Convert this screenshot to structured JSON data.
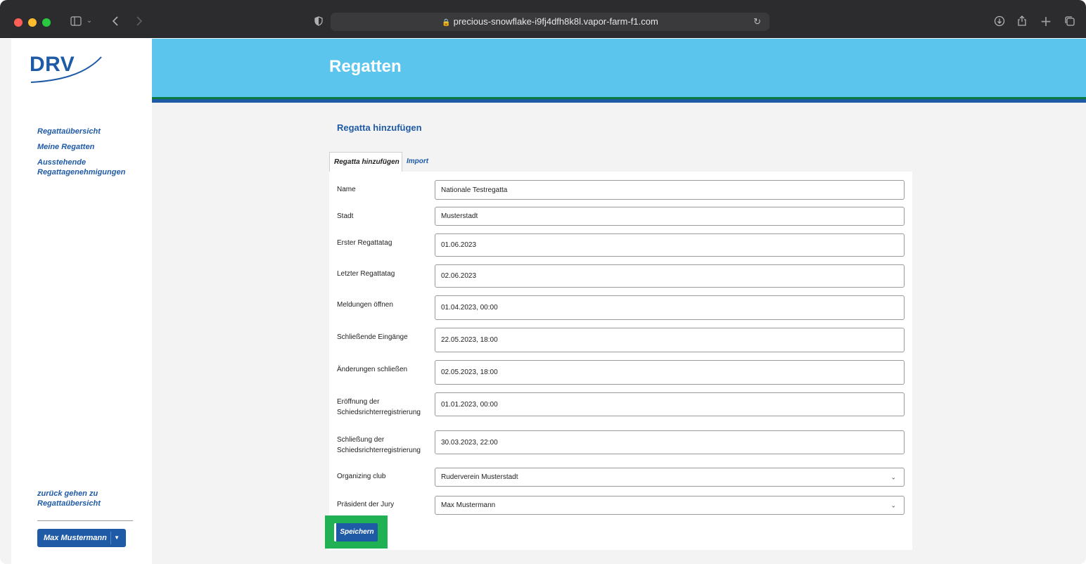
{
  "browser": {
    "url": "precious-snowflake-i9fj4dfh8k8l.vapor-farm-f1.com"
  },
  "sidebar": {
    "logo_text": "DRV",
    "nav_items": [
      "Regattaübersicht",
      "Meine Regatten",
      "Ausstehende Regattagenehmigungen"
    ],
    "back_link": "zurück gehen zu Regattaübersicht",
    "user_name": "Max Mustermann"
  },
  "header": {
    "title": "Regatten"
  },
  "main": {
    "section_title": "Regatta hinzufügen",
    "tabs": [
      {
        "label": "Regatta hinzufügen",
        "active": true
      },
      {
        "label": "Import",
        "active": false
      }
    ],
    "fields": [
      {
        "label": "Name",
        "value": "Nationale Testregatta",
        "type": "text"
      },
      {
        "label": "Stadt",
        "value": "Musterstadt",
        "type": "text"
      },
      {
        "label": "Erster Regattatag",
        "value": "01.06.2023",
        "type": "date"
      },
      {
        "label": "Letzter Regattatag",
        "value": "02.06.2023",
        "type": "date"
      },
      {
        "label": "Meldungen öffnen",
        "value": "01.04.2023, 00:00",
        "type": "datetime"
      },
      {
        "label": "Schließende Eingänge",
        "value": "22.05.2023, 18:00",
        "type": "datetime"
      },
      {
        "label": "Änderungen schließen",
        "value": "02.05.2023, 18:00",
        "type": "datetime"
      },
      {
        "label_line1": "Eröffnung der",
        "label_line2": "Schiedsrichterregistrierung",
        "value": "01.01.2023, 00:00",
        "type": "datetime"
      },
      {
        "label_line1": "Schließung der",
        "label_line2": "Schiedsrichterregistrierung",
        "value": "30.03.2023, 22:00",
        "type": "datetime"
      },
      {
        "label": "Organizing club",
        "value": "Ruderverein Musterstadt",
        "type": "select"
      },
      {
        "label": "Präsident der Jury",
        "value": "Max Mustermann",
        "type": "select"
      }
    ],
    "save_label": "Speichern"
  },
  "colors": {
    "brand_blue": "#1f5aa6",
    "banner": "#5bc5ee",
    "stripe_green": "#0b7a3e",
    "highlight_green": "#1fb154"
  }
}
